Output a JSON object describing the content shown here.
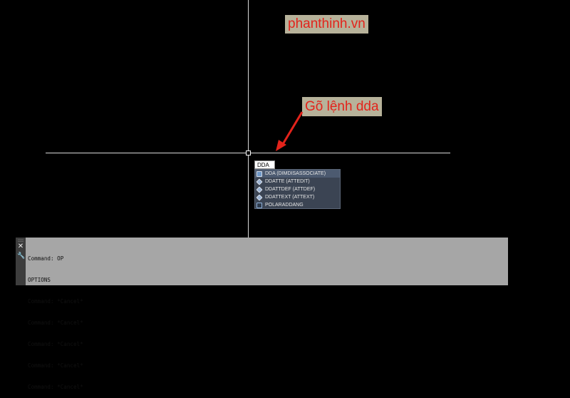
{
  "watermark": "phanthinh.vn",
  "annotation": "Gõ lệnh dda",
  "command_input": "DDA",
  "autocomplete": [
    {
      "label": "DDA (DIMDISASSOCIATE)",
      "icon": "dimension-icon"
    },
    {
      "label": "DDATTE (ATTEDIT)",
      "icon": "attribute-edit-icon"
    },
    {
      "label": "DDATTDEF (ATTDEF)",
      "icon": "attribute-define-icon"
    },
    {
      "label": "DDATTEXT (ATTEXT)",
      "icon": "attribute-extract-icon"
    },
    {
      "label": "POLARADDANG",
      "icon": "polar-angle-icon"
    }
  ],
  "command_history": [
    "Command: OP",
    "OPTIONS",
    "Command: *Cancel*",
    "Command: *Cancel*",
    "Command: *Cancel*",
    "Command: *Cancel*",
    "Command: *Cancel*"
  ],
  "colors": {
    "canvas": "#000000",
    "annotation_text": "#e3231b",
    "annotation_bg": "#b7b29a",
    "suggest_bg": "#3b4453",
    "command_panel": "#a6a6a6"
  }
}
